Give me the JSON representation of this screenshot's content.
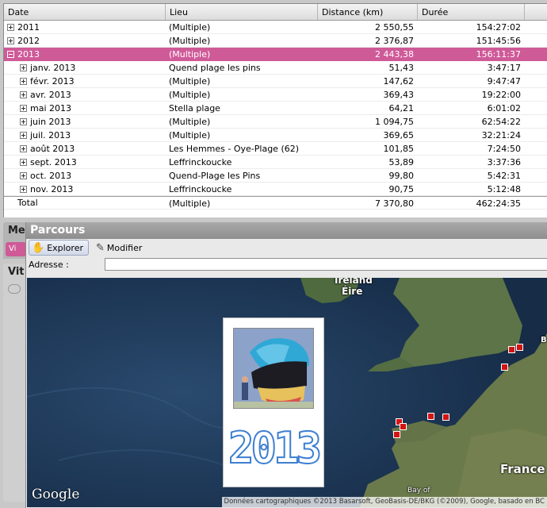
{
  "grid": {
    "columns": [
      "Date",
      "Lieu",
      "Distance (km)",
      "Durée"
    ],
    "rows": [
      {
        "date": "2011",
        "lieu": "(Multiple)",
        "distance": "2 550,55",
        "duree": "154:27:02",
        "level": 0,
        "expander": "plus",
        "selected": false
      },
      {
        "date": "2012",
        "lieu": "(Multiple)",
        "distance": "2 376,87",
        "duree": "151:45:56",
        "level": 0,
        "expander": "plus",
        "selected": false
      },
      {
        "date": "2013",
        "lieu": "(Multiple)",
        "distance": "2 443,38",
        "duree": "156:11:37",
        "level": 0,
        "expander": "minus",
        "selected": true
      },
      {
        "date": "janv. 2013",
        "lieu": "Quend plage les pins",
        "distance": "51,43",
        "duree": "3:47:17",
        "level": 1,
        "expander": "plus",
        "selected": false
      },
      {
        "date": "févr. 2013",
        "lieu": "(Multiple)",
        "distance": "147,62",
        "duree": "9:47:47",
        "level": 1,
        "expander": "plus",
        "selected": false
      },
      {
        "date": "avr. 2013",
        "lieu": "(Multiple)",
        "distance": "369,43",
        "duree": "19:22:00",
        "level": 1,
        "expander": "plus",
        "selected": false
      },
      {
        "date": "mai 2013",
        "lieu": "Stella plage",
        "distance": "64,21",
        "duree": "6:01:02",
        "level": 1,
        "expander": "plus",
        "selected": false
      },
      {
        "date": "juin 2013",
        "lieu": "(Multiple)",
        "distance": "1 094,75",
        "duree": "62:54:22",
        "level": 1,
        "expander": "plus",
        "selected": false
      },
      {
        "date": "juil. 2013",
        "lieu": "(Multiple)",
        "distance": "369,65",
        "duree": "32:21:24",
        "level": 1,
        "expander": "plus",
        "selected": false
      },
      {
        "date": "août 2013",
        "lieu": "Les Hemmes - Oye-Plage (62)",
        "distance": "101,85",
        "duree": "7:24:50",
        "level": 1,
        "expander": "plus",
        "selected": false
      },
      {
        "date": "sept. 2013",
        "lieu": "Leffrinckoucke",
        "distance": "53,89",
        "duree": "3:37:36",
        "level": 1,
        "expander": "plus",
        "selected": false
      },
      {
        "date": "oct. 2013",
        "lieu": "Quend-Plage les Pins",
        "distance": "99,80",
        "duree": "5:42:31",
        "level": 1,
        "expander": "plus",
        "selected": false
      },
      {
        "date": "nov. 2013",
        "lieu": "Leffrinckoucke",
        "distance": "90,75",
        "duree": "5:12:48",
        "level": 1,
        "expander": "plus",
        "selected": false
      }
    ],
    "total": {
      "date": "Total",
      "lieu": "(Multiple)",
      "distance": "7 370,80",
      "duree": "462:24:35"
    }
  },
  "side": {
    "me_label": "Me",
    "me_button": "Vi",
    "vi_label": "Vit"
  },
  "panel": {
    "title": "Parcours",
    "explore_label": "Explorer",
    "modify_label": "Modifier",
    "address_label": "Adresse :",
    "address_value": ""
  },
  "map": {
    "labels": {
      "ireland": "Ireland",
      "eire": "Éire",
      "france": "France",
      "bay": "Bay of",
      "b_edge": "B"
    },
    "google": "Google",
    "copyright": "Données cartographiques ©2013 Basarsoft, GeoBasis-DE/BKG (©2009), Google, basado en BC",
    "popup_year": "2013",
    "marker_color": "#d21414"
  },
  "colors": {
    "selection": "#cf5a98",
    "sea": "#1e3b5c"
  }
}
